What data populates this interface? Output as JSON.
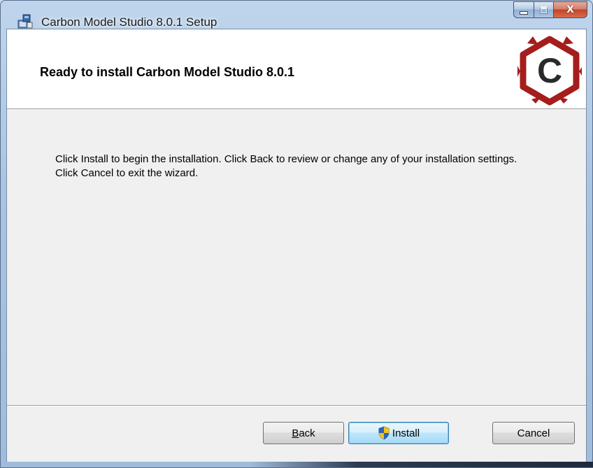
{
  "window": {
    "title": "Carbon Model Studio 8.0.1 Setup",
    "controls": {
      "minimize": "minimize",
      "maximize": "maximize",
      "close": "X"
    }
  },
  "banner": {
    "title": "Ready to install Carbon Model Studio 8.0.1",
    "logo_letter": "C",
    "logo_color": "#a51d1d"
  },
  "body": {
    "instructions": "Click Install to begin the installation. Click Back to review or change any of your installation settings. Click Cancel to exit the wizard."
  },
  "buttons": {
    "back": {
      "mnemonic": "B",
      "rest": "ack"
    },
    "install": {
      "label": "Install",
      "icon": "uac-shield-icon"
    },
    "cancel": {
      "label": "Cancel"
    }
  }
}
